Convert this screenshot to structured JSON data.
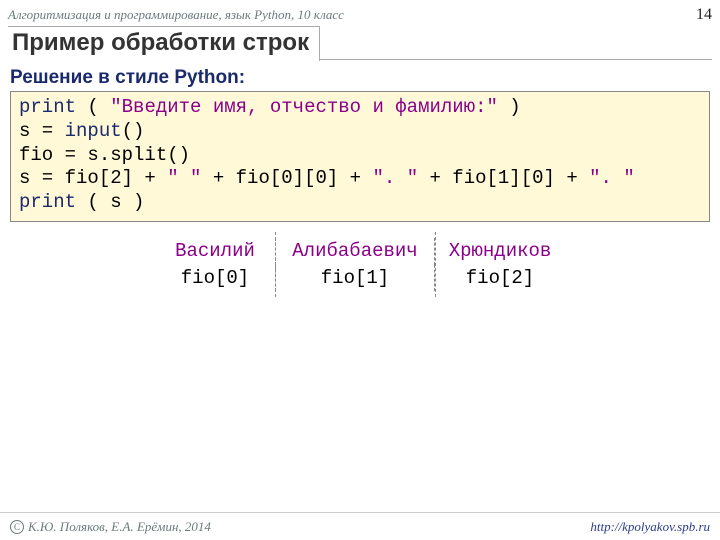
{
  "header": {
    "course": "Алгоритмизация и программирование, язык Python, 10 класс",
    "page": "14",
    "title": "Пример обработки строк"
  },
  "subtitle": "Решение в стиле Python:",
  "code": {
    "l1_kw": "print",
    "l1_a": " ( ",
    "l1_str": "\"Введите имя, отчество и фамилию:\"",
    "l1_b": " )",
    "l2_a": "s = ",
    "l2_kw": "input",
    "l2_b": "()",
    "l3": "fio = s.split()",
    "l4_a": "s = fio[2] + ",
    "l4_s1": "\" \"",
    "l4_b": " + fio[0][0] + ",
    "l4_s2": "\". \"",
    "l4_c": " + fio[1][0] + ",
    "l4_s3": "\". \"",
    "l5_kw": "print",
    "l5_a": " ( s )"
  },
  "example": {
    "name1": "Василий",
    "name2": "Алибабаевич",
    "name3": "Хрюндиков",
    "idx1": "fio[0]",
    "idx2": "fio[1]",
    "idx3": "fio[2]"
  },
  "footer": {
    "copyright_symbol": "С",
    "left": "К.Ю. Поляков, Е.А. Ерёмин, 2014",
    "right": "http://kpolyakov.spb.ru"
  }
}
